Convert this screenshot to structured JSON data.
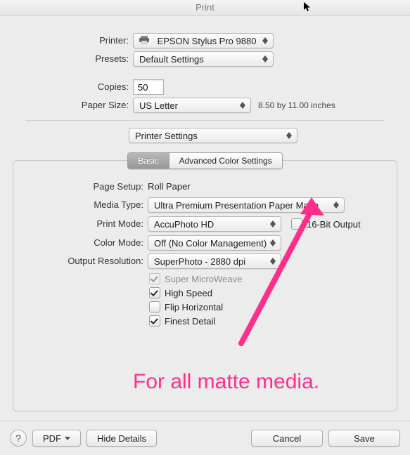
{
  "titlebar": {
    "title": "Print"
  },
  "labels": {
    "printer": "Printer:",
    "presets": "Presets:",
    "copies": "Copies:",
    "paperSize": "Paper Size:",
    "pageSetup": "Page Setup:",
    "mediaType": "Media Type:",
    "printMode": "Print Mode:",
    "colorMode": "Color Mode:",
    "outputResolution": "Output Resolution:"
  },
  "values": {
    "printer": "EPSON Stylus Pro 9880",
    "presets": "Default Settings",
    "copies": "50",
    "paperSize": "US Letter",
    "paperSizeNote": "8.50 by 11.00 inches",
    "sectionPopup": "Printer Settings",
    "pageSetup": "Roll Paper",
    "mediaType": "Ultra Premium Presentation Paper Matte",
    "printMode": "AccuPhoto HD",
    "colorMode": "Off (No Color Management)",
    "outputResolution": "SuperPhoto - 2880 dpi",
    "bitOutput": "16-Bit Output"
  },
  "tabs": {
    "basic": "Basic",
    "advanced": "Advanced Color Settings"
  },
  "checkboxes": {
    "superMicroweave": "Super MicroWeave",
    "highSpeed": "High Speed",
    "flipHorizontal": "Flip Horizontal",
    "finestDetail": "Finest Detail"
  },
  "bottom": {
    "pdf": "PDF",
    "hideDetails": "Hide Details",
    "cancel": "Cancel",
    "save": "Save"
  },
  "annotation": "For all matte media."
}
